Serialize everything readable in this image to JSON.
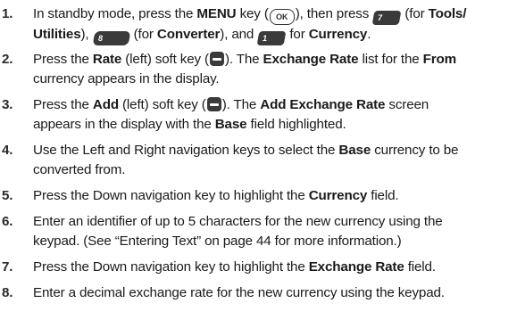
{
  "steps": [
    {
      "number": "1.",
      "line1": {
        "a": "In standby mode, press the ",
        "menu": "MENU",
        "b": " key (",
        "ok_key": "OK",
        "c": "), then press ",
        "key7": "7",
        "d": " (for ",
        "tools": "Tools/"
      },
      "line2": {
        "utilities": "Utilities",
        "a": "), ",
        "key8": "8",
        "b": " (for ",
        "converter": "Converter",
        "c": "), and ",
        "key1": "1",
        "d": " for ",
        "currency": "Currency",
        "e": "."
      }
    },
    {
      "number": "2.",
      "line1": {
        "a": "Press the ",
        "rate": "Rate",
        "b": " (left) soft key (",
        "c": "). The ",
        "exchange_rate": "Exchange Rate",
        "d": " list for the ",
        "from": "From"
      },
      "line2": {
        "a": "currency appears in the display."
      }
    },
    {
      "number": "3.",
      "line1": {
        "a": "Press the ",
        "add": "Add",
        "b": " (left) soft key (",
        "c": "). The ",
        "add_exchange_rate": "Add Exchange Rate",
        "d": " screen"
      },
      "line2": {
        "a": "appears in the display with the ",
        "base": "Base",
        "b": " field highlighted."
      }
    },
    {
      "number": "4.",
      "line1": {
        "a": "Use the Left and Right navigation keys to select the ",
        "base": "Base",
        "b": " currency to be"
      },
      "line2": {
        "a": "converted from."
      }
    },
    {
      "number": "5.",
      "line1": {
        "a": "Press the Down navigation key to highlight the ",
        "currency": "Currency",
        "b": " field."
      }
    },
    {
      "number": "6.",
      "line1": {
        "a": "Enter an identifier of up to 5 characters for the new currency using the"
      },
      "line2": {
        "a": "keypad. (See “Entering Text” on page 44 for more information.)"
      }
    },
    {
      "number": "7.",
      "line1": {
        "a": "Press the Down navigation key to highlight the ",
        "exchange_rate": "Exchange Rate",
        "b": " field."
      }
    },
    {
      "number": "8.",
      "line1": {
        "a": "Enter a decimal exchange rate for the new currency using the keypad."
      }
    }
  ]
}
